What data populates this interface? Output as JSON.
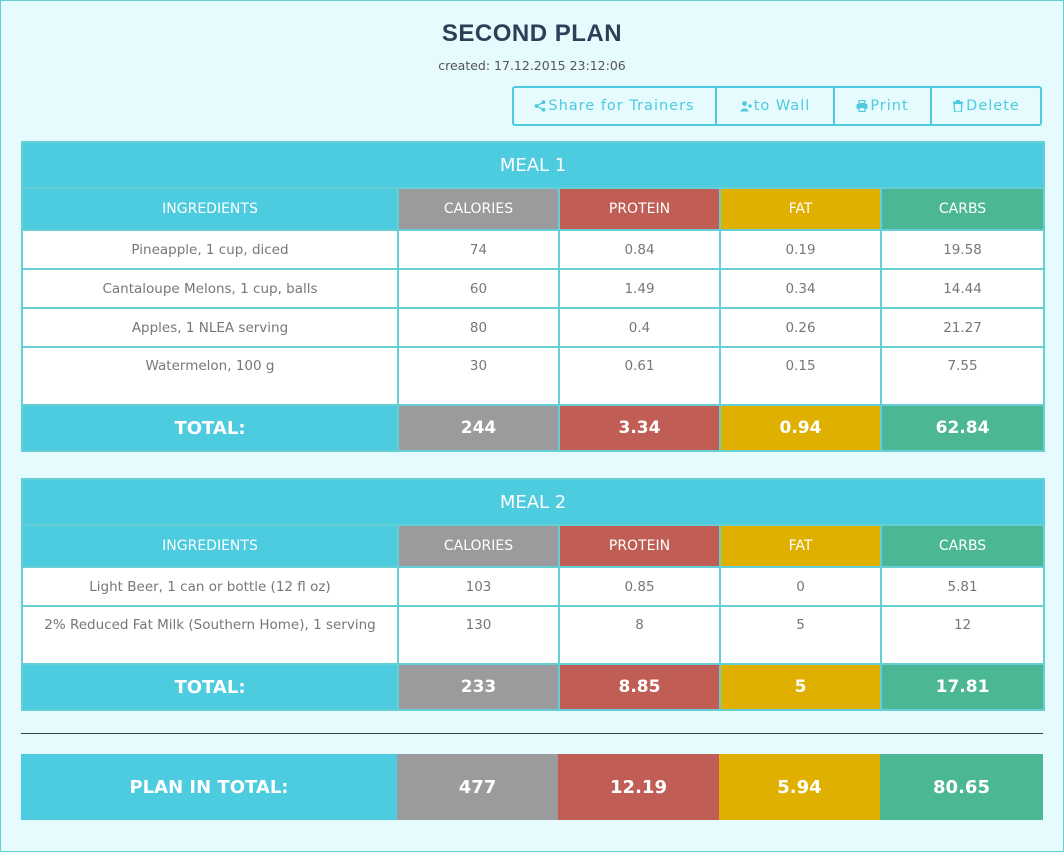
{
  "plan": {
    "title": "SECOND PLAN",
    "created": "created: 17.12.2015 23:12:06"
  },
  "toolbar": {
    "share_label": "Share for Trainers",
    "wall_label": "to Wall",
    "print_label": "Print",
    "delete_label": "Delete"
  },
  "columns": {
    "ingredients": "INGREDIENTS",
    "calories": "CALORIES",
    "protein": "PROTEIN",
    "fat": "FAT",
    "carbs": "CARBS"
  },
  "colors": {
    "accent": "#4dcbdf",
    "calories": "#9b9a9c",
    "protein": "#c05e55",
    "fat": "#e0b000",
    "carbs": "#4bb795"
  },
  "meals": [
    {
      "title": "MEAL 1",
      "items": [
        {
          "name": "Pineapple, 1 cup, diced",
          "calories": "74",
          "protein": "0.84",
          "fat": "0.19",
          "carbs": "19.58"
        },
        {
          "name": "Cantaloupe Melons, 1 cup, balls",
          "calories": "60",
          "protein": "1.49",
          "fat": "0.34",
          "carbs": "14.44"
        },
        {
          "name": "Apples, 1 NLEA serving",
          "calories": "80",
          "protein": "0.4",
          "fat": "0.26",
          "carbs": "21.27"
        },
        {
          "name": "Watermelon, 100 g",
          "calories": "30",
          "protein": "0.61",
          "fat": "0.15",
          "carbs": "7.55"
        }
      ],
      "total": {
        "label": "TOTAL:",
        "calories": "244",
        "protein": "3.34",
        "fat": "0.94",
        "carbs": "62.84"
      }
    },
    {
      "title": "MEAL 2",
      "items": [
        {
          "name": "Light Beer, 1 can or bottle (12 fl oz)",
          "calories": "103",
          "protein": "0.85",
          "fat": "0",
          "carbs": "5.81"
        },
        {
          "name": "2% Reduced Fat Milk (Southern Home), 1 serving",
          "calories": "130",
          "protein": "8",
          "fat": "5",
          "carbs": "12"
        }
      ],
      "total": {
        "label": "TOTAL:",
        "calories": "233",
        "protein": "8.85",
        "fat": "5",
        "carbs": "17.81"
      }
    }
  ],
  "plan_total": {
    "label": "PLAN IN TOTAL:",
    "calories": "477",
    "protein": "12.19",
    "fat": "5.94",
    "carbs": "80.65"
  }
}
